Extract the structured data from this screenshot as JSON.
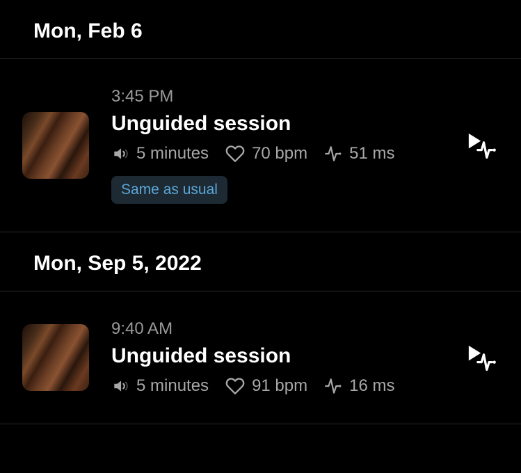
{
  "sections": [
    {
      "header": "Mon, Feb 6",
      "sessions": [
        {
          "time": "3:45 PM",
          "title": "Unguided session",
          "duration": "5 minutes",
          "bpm": "70 bpm",
          "hrv": "51 ms",
          "tag": "Same as usual"
        }
      ]
    },
    {
      "header": "Mon, Sep 5, 2022",
      "sessions": [
        {
          "time": "9:40 AM",
          "title": "Unguided session",
          "duration": "5 minutes",
          "bpm": "91 bpm",
          "hrv": "16 ms",
          "tag": null
        }
      ]
    }
  ]
}
